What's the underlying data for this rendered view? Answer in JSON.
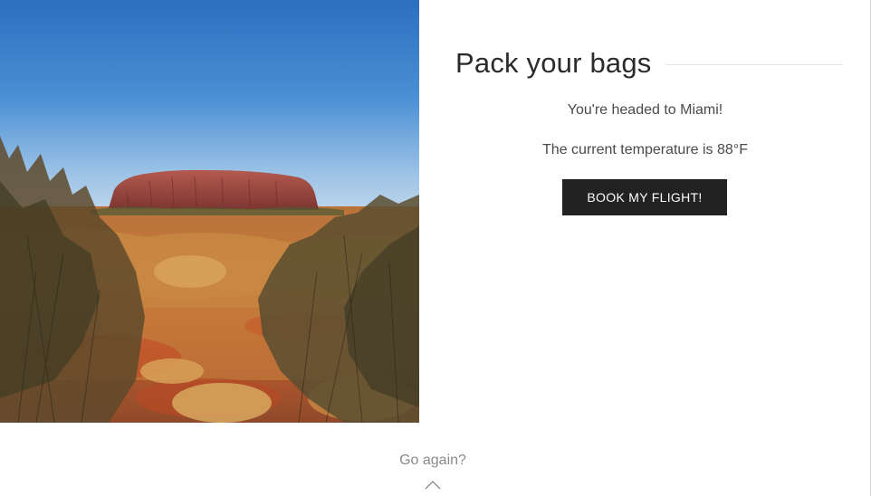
{
  "photo": {
    "icon": "uluru-landscape-image"
  },
  "main": {
    "heading": "Pack your bags",
    "destination_text": "You're headed to Miami!",
    "temperature_text": "The current temperature is 88°F",
    "book_button_label": "BOOK MY FLIGHT!"
  },
  "footer": {
    "go_again_label": "Go again?",
    "chevron_icon": "chevron-up-icon"
  },
  "colors": {
    "button_bg": "#222222",
    "button_text": "#ffffff",
    "heading": "#2b2b2b",
    "body_text": "#4a4a4a",
    "muted_text": "#8a8a8a",
    "sky_top": "#2f72c2",
    "sky_bottom": "#a9cbe7",
    "rock": "#a0473f",
    "ground": "#c9692f"
  }
}
